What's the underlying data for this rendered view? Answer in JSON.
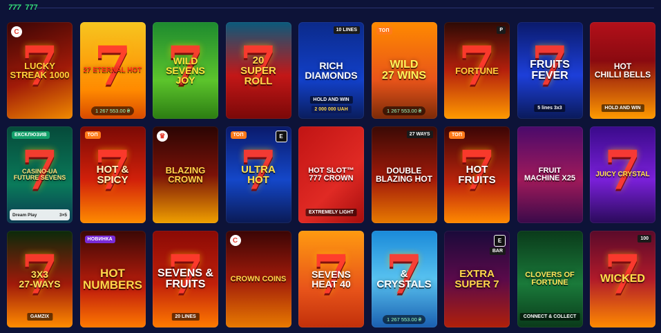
{
  "header": {
    "icon": "777-icon",
    "icon_text": "777",
    "title": "777"
  },
  "accent": "#35e07a",
  "tiles": [
    {
      "title": "Lucky\nStreak 1000",
      "bg": "linear-gradient(160deg,#3a0505,#a01a08 55%,#f08a00)",
      "color": "#ffd23a",
      "size": 13,
      "seven": true,
      "corner_logo": "C"
    },
    {
      "title": "27 Eternal Hot",
      "bg": "linear-gradient(180deg,#f7c51f,#ff8a00 70%,#d84a00)",
      "color": "#ff2d16",
      "size": 10,
      "seven": true,
      "jackpot": "1 267 553.00 ₴"
    },
    {
      "title": "Wild\nSevens Joy",
      "bg": "linear-gradient(180deg,#1d8a2f,#5cc42c 60%,#2c7d12)",
      "color": "#ffe23a",
      "size": 14,
      "seven": true
    },
    {
      "title": "20\nSuper\nRoll",
      "bg": "linear-gradient(180deg,#0a5a7c,#c31717 55%,#7a0808)",
      "color": "#ffd84a",
      "size": 15,
      "seven": true
    },
    {
      "title": "Rich\nDiamonds",
      "bg": "linear-gradient(180deg,#0b2a8a,#1240c9 60%,#0a1d5c)",
      "color": "#ffffff",
      "size": 14,
      "corner_label": "10 LINES",
      "subline": "HOLD AND WIN",
      "sub2": "2 000 000 UAH"
    },
    {
      "title": "Wild\n27 Wins",
      "bg": "linear-gradient(180deg,#ff8a00,#e8541a 60%,#7a2a08)",
      "color": "#fff35a",
      "size": 16,
      "badge": "ТОП",
      "badge_type": "top",
      "jackpot": "1 267 553.00 ₴"
    },
    {
      "title": "Fortune",
      "bg": "linear-gradient(180deg,#2c0a05,#b5200c 50%,#ff9a00)",
      "color": "#ffcb3a",
      "size": 13,
      "seven": true,
      "corner_label": "P"
    },
    {
      "title": "Fruits\nFever",
      "bg": "linear-gradient(180deg,#0a1a6b,#1d3fd9 55%,#0a1a5a)",
      "color": "#ffffff",
      "size": 16,
      "seven": true,
      "subline": "5 lines 3x3"
    },
    {
      "title": "Hot\nChilli Bells",
      "bg": "linear-gradient(180deg,#b3101a,#8a0a10 40%,#ff9a00)",
      "color": "#ffffff",
      "size": 12,
      "subline": "HOLD AND WIN"
    },
    {
      "title": "Casino-UA\nFuture Sevens",
      "bg": "linear-gradient(180deg,#064a3a,#0a7a5a 60%,#0b3a52)",
      "color": "#ffe07a",
      "size": 9,
      "seven": true,
      "badge": "ЕКСКЛЮЗИВ",
      "badge_type": "excl",
      "footer_left": "Dream Play",
      "footer_right": "3×5"
    },
    {
      "title": "Hot &\nSpicy",
      "bg": "linear-gradient(180deg,#7a0a05,#d1200a 55%,#ff8c00)",
      "color": "#fff4c0",
      "size": 15,
      "seven": true,
      "badge": "ТОП",
      "badge_type": "top"
    },
    {
      "title": "Blazing\nCrown",
      "bg": "linear-gradient(180deg,#2a0503,#7a1208 50%,#f0a000)",
      "color": "#ffd24a",
      "size": 13,
      "corner_logo": "♛"
    },
    {
      "title": "Ultra\nHot",
      "bg": "linear-gradient(180deg,#0a1a6b,#1447c9 55%,#0a1a55)",
      "color": "#ffe14a",
      "size": 15,
      "seven": true,
      "badge": "ТОП",
      "badge_type": "top",
      "corner_box": "E"
    },
    {
      "title": "Hot Slot™\n777 Crown",
      "bg": "linear-gradient(135deg,#c11414,#e02a24 60%,#a50d0d)",
      "color": "#ffffff",
      "size": 11,
      "subline": "EXTREMELY LIGHT"
    },
    {
      "title": "Double\nBlazing Hot",
      "bg": "linear-gradient(180deg,#3a0a05,#a31a0a 55%,#e87a00)",
      "color": "#ffffff",
      "size": 12,
      "corner_label": "27 WAYS"
    },
    {
      "title": "Hot\nFruits",
      "bg": "linear-gradient(180deg,#3a0505,#c1260c 60%,#ff8a00)",
      "color": "#ffffff",
      "size": 15,
      "seven": true,
      "badge": "ТОП",
      "badge_type": "top"
    },
    {
      "title": "Fruit\nMachine x25",
      "bg": "linear-gradient(180deg,#4a0a6b,#a01a5a 55%,#3a0a4a)",
      "color": "#ffffff",
      "size": 11
    },
    {
      "title": "Juicy Crystal",
      "bg": "linear-gradient(180deg,#3a0a8a,#7a20d9 55%,#2a0a5a)",
      "color": "#ffe14a",
      "size": 10,
      "seven": true
    },
    {
      "title": "3x3\n27-Ways",
      "bg": "linear-gradient(180deg,#0a2a0a,#a01a0a 55%,#ff8c00)",
      "color": "#ffe35a",
      "size": 14,
      "seven": true,
      "subline": "GAMZIX"
    },
    {
      "title": "Hot\nNumbers",
      "bg": "linear-gradient(180deg,#3a0805,#c11e0c 60%,#ff7a00)",
      "color": "#ffd64a",
      "size": 17,
      "badge": "НОВИНКА",
      "badge_type": "new"
    },
    {
      "title": "Sevens &\nFruits",
      "bg": "linear-gradient(180deg,#8a0a05,#c1200a 55%,#ff7a00)",
      "color": "#ffffff",
      "size": 16,
      "seven": true,
      "subline": "20 LINES"
    },
    {
      "title": "Crown Coins",
      "bg": "linear-gradient(180deg,#3a0505,#a01a0a 50%,#e87a00)",
      "color": "#ffd84a",
      "size": 11,
      "corner_logo": "C"
    },
    {
      "title": "Sevens\nHeat 40",
      "bg": "linear-gradient(180deg,#ff9a10,#e8541a 60%,#c1300a)",
      "color": "#ffffff",
      "size": 14,
      "seven": true
    },
    {
      "title": "&\nCrystals",
      "bg": "linear-gradient(180deg,#1a8ad9,#58c2f0 50%,#1a5fb0)",
      "color": "#ffffff",
      "size": 15,
      "seven": true,
      "jackpot": "1 267 553.00 ₴"
    },
    {
      "title": "Extra\nSuper 7",
      "bg": "linear-gradient(180deg,#1a0a3a,#5a0a4a 50%,#b0200a)",
      "color": "#ffd84a",
      "size": 15,
      "corner_box": "E",
      "corner_label": "BAR"
    },
    {
      "title": "Clovers of\nFortune",
      "bg": "linear-gradient(180deg,#0a3a1a,#1a7a3a 55%,#0a3a1a)",
      "color": "#ffe35a",
      "size": 11,
      "subline": "CONNECT & COLLECT"
    },
    {
      "title": "Wicked",
      "bg": "linear-gradient(180deg,#5a0a2a,#b01a2a 50%,#ff8a00)",
      "color": "#ffe14a",
      "size": 16,
      "seven": true,
      "corner_label": "100"
    }
  ]
}
